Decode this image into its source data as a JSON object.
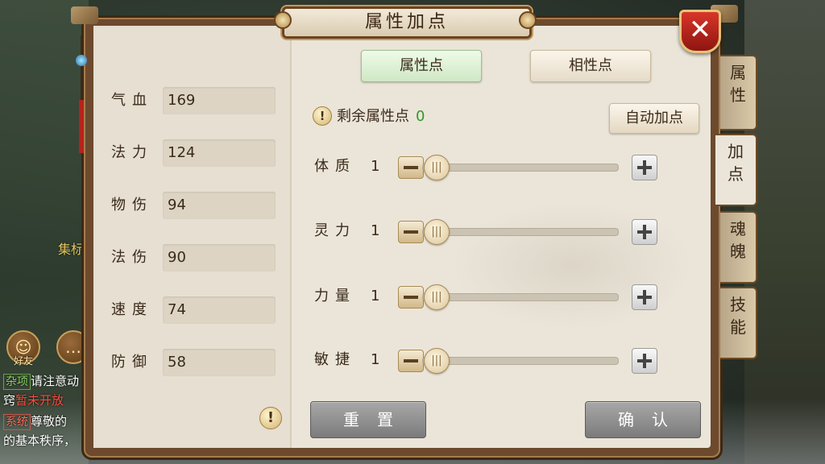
{
  "window": {
    "title": "属性加点",
    "close_label": "✕"
  },
  "left_stats": [
    {
      "label": "气血",
      "value": "169"
    },
    {
      "label": "法力",
      "value": "124"
    },
    {
      "label": "物伤",
      "value": "94"
    },
    {
      "label": "法伤",
      "value": "90"
    },
    {
      "label": "速度",
      "value": "74"
    },
    {
      "label": "防御",
      "value": "58"
    }
  ],
  "tabs": {
    "attribute_points": "属性点",
    "affinity_points": "相性点"
  },
  "remaining": {
    "label": "剩余属性点",
    "value": "0"
  },
  "auto_button": "自动加点",
  "attributes": [
    {
      "label": "体质",
      "value": "1",
      "slider_level": 0
    },
    {
      "label": "灵力",
      "value": "1",
      "slider_level": 0
    },
    {
      "label": "力量",
      "value": "1",
      "slider_level": 0
    },
    {
      "label": "敏捷",
      "value": "1",
      "slider_level": 0
    }
  ],
  "reset_button": "重置",
  "confirm_button": "确认",
  "side_tabs": [
    {
      "label": "属\n性"
    },
    {
      "label": "加\n点",
      "active": true
    },
    {
      "label": "魂\n魄"
    },
    {
      "label": "技\n能"
    }
  ],
  "background": {
    "friends_label": "好友",
    "side_text": "集标",
    "chat": [
      {
        "tag": "杂项",
        "text": "请注意动",
        "tag_type": "misc"
      },
      {
        "text_plain": "窍",
        "text_red": "暂未开放"
      },
      {
        "tag": "系统",
        "text": "尊敬的",
        "tag_type": "system"
      },
      {
        "text_plain": "的基本秩序，"
      }
    ]
  },
  "colors": {
    "accent_green": "#2f9a2a",
    "close_red": "#c22b20",
    "panel_paper": "#ebe5d9",
    "frame_brown": "#6d4a2e"
  }
}
